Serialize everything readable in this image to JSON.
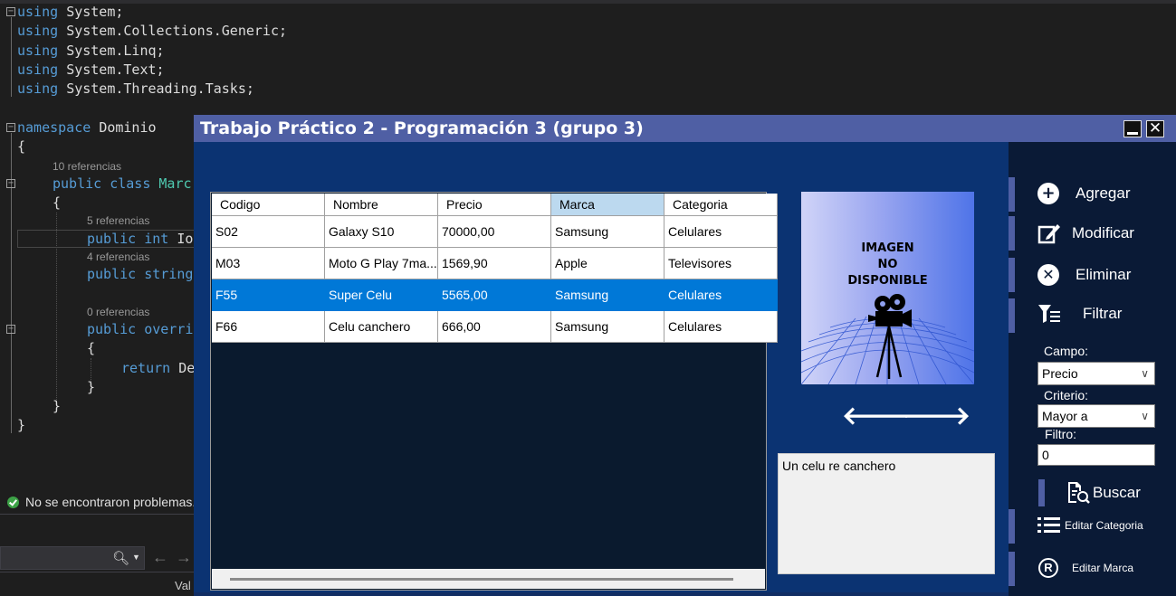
{
  "editor": {
    "usings": [
      "System;",
      "System.Collections.Generic;",
      "System.Linq;",
      "System.Text;",
      "System.Threading.Tasks;"
    ],
    "using_kw": "using",
    "namespace_kw": "namespace",
    "namespace_name": "Dominio",
    "open_brace": "{",
    "close_brace": "}",
    "class_refs": "10 referencias",
    "class_line_kw": "public class",
    "class_name": "Marc",
    "prop1_refs": "5 referencias",
    "prop1_kw": "public int",
    "prop1_name": "Io",
    "prop2_refs": "4 referencias",
    "prop2_kw": "public string",
    "method_refs": "0 referencias",
    "method_kw": "public overri",
    "return_kw": "return",
    "return_rest": "De"
  },
  "status": {
    "text": "No se encontraron problemas.",
    "search_icon": "magnifier-icon",
    "val_text": "Val"
  },
  "form": {
    "title": "Trabajo Práctico 2 - Programación 3 (grupo 3)",
    "close_glyph": "✕",
    "grid": {
      "columns": [
        "Codigo",
        "Nombre",
        "Precio",
        "Marca",
        "Categoria"
      ],
      "selected_column": "Marca",
      "rows": [
        [
          "S02",
          "Galaxy S10",
          "70000,00",
          "Samsung",
          "Celulares"
        ],
        [
          "M03",
          "Moto G Play 7ma...",
          "1569,90",
          "Apple",
          "Televisores"
        ],
        [
          "F55",
          "Super Celu",
          "5565,00",
          "Samsung",
          "Celulares"
        ],
        [
          "F66",
          "Celu canchero",
          "666,00",
          "Samsung",
          "Celulares"
        ]
      ],
      "selected_row": 2
    },
    "image": {
      "lines": [
        "IMAGEN",
        "NO",
        "DISPONIBLE"
      ],
      "icon": "movie-camera-icon"
    },
    "prev_arrow": "🡐",
    "next_arrow": "🡒",
    "description": "Un celu re canchero",
    "buttons": {
      "agregar": "Agregar",
      "modificar": "Modificar",
      "eliminar": "Eliminar",
      "filtrar": "Filtrar",
      "buscar": "Buscar",
      "editar_categoria": "Editar Categoria",
      "editar_marca": "Editar Marca"
    },
    "filter": {
      "campo_label": "Campo:",
      "campo_value": "Precio",
      "criterio_label": "Criterio:",
      "criterio_value": "Mayor a",
      "filtro_label": "Filtro:",
      "filtro_value": "0"
    },
    "colors": {
      "titlebar": "#4f5fa4",
      "form_body": "#0b3372",
      "right_panel": "#0a1a36",
      "selection": "#0078d7"
    }
  }
}
